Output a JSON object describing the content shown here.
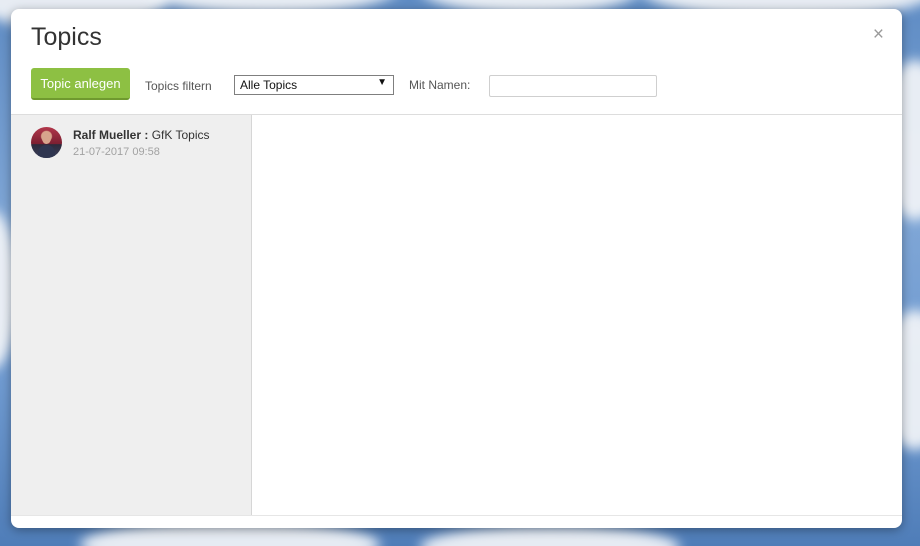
{
  "modal": {
    "title": "Topics",
    "close_label": "×"
  },
  "toolbar": {
    "create_button_label": "Topic anlegen",
    "filter_label": "Topics filtern",
    "filter_selected": "Alle Topics",
    "filter_arrow": "▼",
    "name_label": "Mit Namen:",
    "name_value": "",
    "name_placeholder": ""
  },
  "topics": [
    {
      "author": "Ralf Mueller :",
      "topic": "GfK Topics",
      "date": "21-07-2017 09:58",
      "avatar": "user-avatar-photo"
    }
  ],
  "colors": {
    "accent_green": "#8dc043",
    "sidebar_bg": "#efefef",
    "background_sky": "#6f9ad0"
  }
}
